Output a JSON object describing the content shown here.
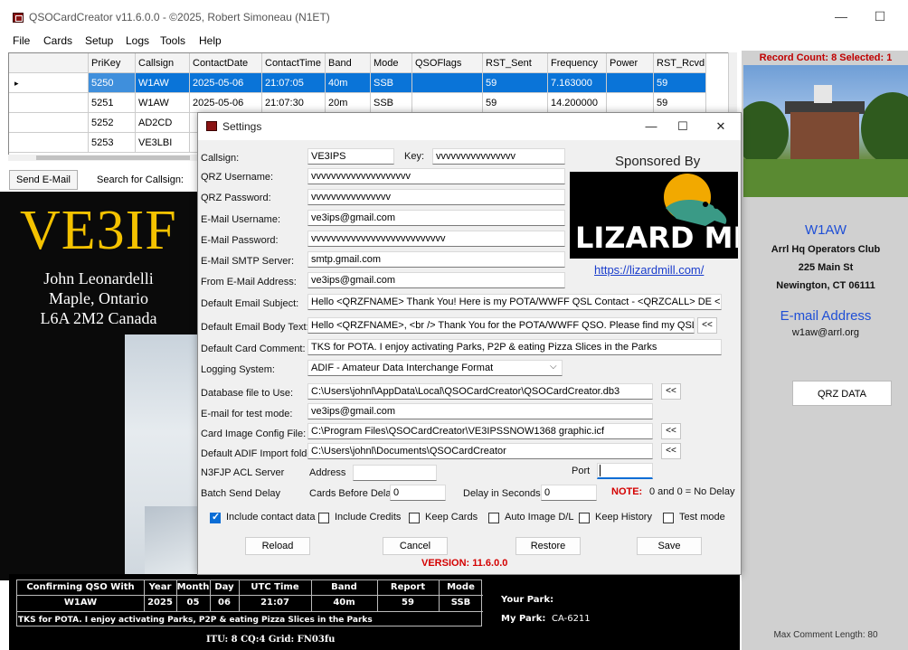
{
  "window": {
    "title": "QSOCardCreator v11.6.0.0 - ©2025, Robert Simoneau (N1ET)"
  },
  "menu": [
    "File",
    "Cards",
    "Setup",
    "Logs",
    "Tools",
    "Help"
  ],
  "grid": {
    "columns": [
      "PriKey",
      "Callsign",
      "ContactDate",
      "ContactTime",
      "Band",
      "Mode",
      "QSOFlags",
      "RST_Sent",
      "Frequency",
      "Power",
      "RST_Rcvd"
    ],
    "rows": [
      [
        "5250",
        "W1AW",
        "2025-05-06",
        "21:07:05",
        "40m",
        "SSB",
        "",
        "59",
        "7.163000",
        "",
        "59"
      ],
      [
        "5251",
        "W1AW",
        "2025-05-06",
        "21:07:30",
        "20m",
        "SSB",
        "",
        "59",
        "14.200000",
        "",
        "59"
      ],
      [
        "5252",
        "AD2CD",
        "",
        "",
        "",
        "",
        "",
        "",
        "",
        "",
        ""
      ],
      [
        "5253",
        "VE3LBI",
        "",
        "",
        "",
        "",
        "",
        "",
        "",
        "",
        ""
      ]
    ]
  },
  "toolbar": {
    "send_email": "Send E-Mail",
    "search_label": "Search for Callsign:"
  },
  "card": {
    "callsign": "VE3IF",
    "name": "John Leonardelli",
    "city": "Maple, Ontario",
    "postal": "L6A 2M2 Canada",
    "table_headers": [
      "Confirming QSO With",
      "Year",
      "Month",
      "Day",
      "UTC Time",
      "Band",
      "Report",
      "Mode"
    ],
    "table_values": [
      "W1AW",
      "2025",
      "05",
      "06",
      "21:07",
      "40m",
      "59",
      "SSB"
    ],
    "comment": "TKS for POTA. I enjoy activating Parks, P2P & eating Pizza Slices in the Parks",
    "your_park_label": "Your Park:",
    "my_park_label": "My Park:",
    "my_park_value": "CA-6211",
    "grid_line": "ITU: 8 CQ:4 Grid: FN03fu"
  },
  "right_panel": {
    "record_count": "Record Count: 8 Selected: 1",
    "callsign": "W1AW",
    "club": "Arrl Hq Operators Club",
    "street": "225 Main St",
    "city": "Newington, CT 06111",
    "email_heading": "E-mail Address",
    "email": "w1aw@arrl.org",
    "qrz_button": "QRZ DATA",
    "max_comment": "Max Comment Length: 80"
  },
  "settings": {
    "title": "Settings",
    "labels": {
      "callsign": "Callsign:",
      "key": "Key:",
      "qrz_user": "QRZ Username:",
      "qrz_pass": "QRZ Password:",
      "email_user": "E-Mail Username:",
      "email_pass": "E-Mail Password:",
      "smtp": "E-Mail SMTP Server:",
      "from_email": "From E-Mail Address:",
      "subject": "Default Email Subject:",
      "body": "Default Email Body Text:",
      "card_comment": "Default Card Comment:",
      "logging": "Logging System:",
      "db_file": "Database file to Use:",
      "test_email": "E-mail for test mode:",
      "card_config": "Card Image Config File:",
      "adif_folder": "Default ADIF Import folder:",
      "acl_server": "N3FJP ACL Server",
      "address": "Address",
      "port": "Port",
      "batch_delay": "Batch Send Delay",
      "cards_before_delay": "Cards Before Delay",
      "delay_seconds": "Delay in Seconds",
      "note": "NOTE:",
      "note_text": "0 and 0 = No Delay"
    },
    "values": {
      "callsign": "VE3IPS",
      "key": "vvvvvvvvvvvvvvvv",
      "qrz_user": "vvvvvvvvvvvvvvvvvvvv",
      "qrz_pass": "vvvvvvvvvvvvvvvv",
      "email_user": "ve3ips@gmail.com",
      "email_pass": "vvvvvvvvvvvvvvvvvvvvvvvvvvv",
      "smtp": "smtp.gmail.com",
      "from_email": "ve3ips@gmail.com",
      "subject": "Hello <QRZFNAME> Thank You!  Here is my POTA/WWFF QSL Contact - <QRZCALL> DE <MYCALL>",
      "body": "Hello <QRZFNAME>, <br /> Thank You for the POTA/WWFF QSO. Please find my QSL card attach",
      "card_comment": "TKS for POTA. I enjoy activating Parks, P2P & eating Pizza Slices in the Parks",
      "logging": "ADIF - Amateur Data Interchange Format",
      "db_file": "C:\\Users\\johnl\\AppData\\Local\\QSOCardCreator\\QSOCardCreator.db3",
      "test_email": "ve3ips@gmail.com",
      "card_config": "C:\\Program Files\\QSOCardCreator\\VE3IPSSNOW1368 graphic.icf",
      "adif_folder": "C:\\Users\\johnl\\Documents\\QSOCardCreator",
      "address": "",
      "port": "",
      "cards_before_delay": "0",
      "delay_seconds": "0"
    },
    "browse": "<<",
    "checkboxes": [
      {
        "label": "Include contact data",
        "checked": true
      },
      {
        "label": "Include Credits",
        "checked": false
      },
      {
        "label": "Keep Cards",
        "checked": false
      },
      {
        "label": "Auto Image D/L",
        "checked": false
      },
      {
        "label": "Keep History",
        "checked": false
      },
      {
        "label": "Test mode",
        "checked": false
      }
    ],
    "buttons": {
      "reload": "Reload",
      "cancel": "Cancel",
      "restore": "Restore",
      "save": "Save"
    },
    "version": "VERSION: 11.6.0.0",
    "sponsor": {
      "heading": "Sponsored By",
      "brand": "LIZARD MILL",
      "url": "https://lizardmill.com/"
    }
  },
  "colors": {
    "accent": "#0a74d8",
    "red": "#d40000",
    "card_yellow": "#f4c200",
    "right_blue": "#1f4fd6"
  }
}
